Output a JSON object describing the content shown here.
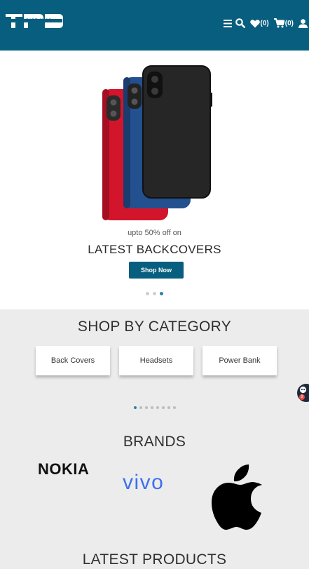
{
  "header": {
    "logo_text": "THE PART SHOP",
    "wishlist_count": "(0)",
    "cart_count": "(0)",
    "icons": [
      "menu-icon",
      "search-icon",
      "heart-icon",
      "cart-icon",
      "user-icon"
    ],
    "background": "#075e7e"
  },
  "hero": {
    "subtitle": "upto 50% off on",
    "title": "LATEST BACKCOVERS",
    "button_label": "Shop Now",
    "slide_count": 3,
    "active_slide": 3
  },
  "category": {
    "title": "SHOP BY CATEGORY",
    "items": [
      "Back Covers",
      "Headsets",
      "Power Bank"
    ],
    "page_count": 8,
    "active_page": 1
  },
  "brands": {
    "title": "BRANDS",
    "items": [
      "NOKIA",
      "vivo",
      "apple-logo"
    ]
  },
  "latest": {
    "title": "LATEST PRODUCTS"
  },
  "chat": {
    "badge": "9"
  }
}
